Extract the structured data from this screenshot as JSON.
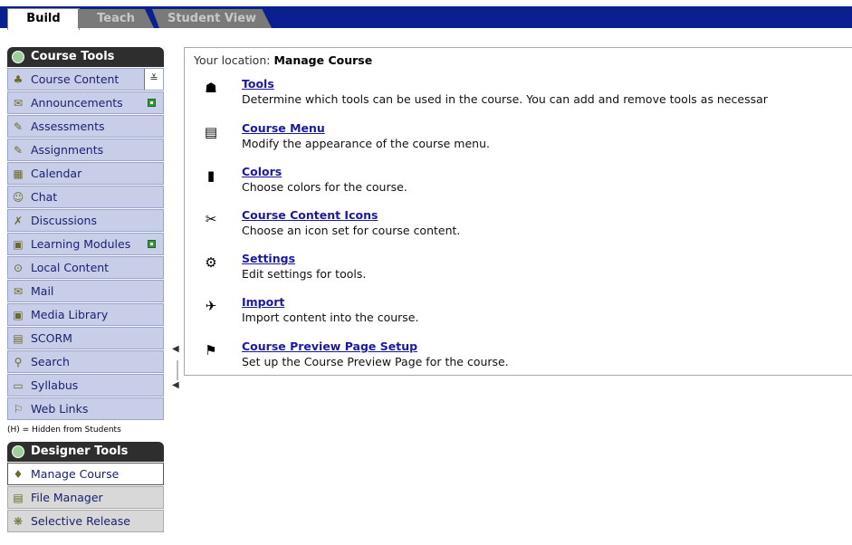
{
  "tabs": {
    "build": "Build",
    "teach": "Teach",
    "student_view": "Student View"
  },
  "sidebar": {
    "course_tools_title": "Course Tools",
    "course_tools": [
      {
        "label": "Course Content",
        "icon": "course-content-icon",
        "glyph": "♣",
        "badge": "chevron"
      },
      {
        "label": "Announcements",
        "icon": "announcements-icon",
        "glyph": "✉",
        "badge": "green"
      },
      {
        "label": "Assessments",
        "icon": "assessments-icon",
        "glyph": "✎"
      },
      {
        "label": "Assignments",
        "icon": "assignments-icon",
        "glyph": "✎"
      },
      {
        "label": "Calendar",
        "icon": "calendar-icon",
        "glyph": "▦"
      },
      {
        "label": "Chat",
        "icon": "chat-icon",
        "glyph": "☺"
      },
      {
        "label": "Discussions",
        "icon": "discussions-icon",
        "glyph": "✗"
      },
      {
        "label": "Learning Modules",
        "icon": "learning-modules-icon",
        "glyph": "▣",
        "badge": "green"
      },
      {
        "label": "Local Content",
        "icon": "local-content-icon",
        "glyph": "⊙"
      },
      {
        "label": "Mail",
        "icon": "mail-icon",
        "glyph": "✉"
      },
      {
        "label": "Media Library",
        "icon": "media-library-icon",
        "glyph": "▣"
      },
      {
        "label": "SCORM",
        "icon": "scorm-icon",
        "glyph": "▤"
      },
      {
        "label": "Search",
        "icon": "search-icon",
        "glyph": "⚲"
      },
      {
        "label": "Syllabus",
        "icon": "syllabus-icon",
        "glyph": "▭"
      },
      {
        "label": "Web Links",
        "icon": "web-links-icon",
        "glyph": "⚐"
      }
    ],
    "hidden_note": "(H) = Hidden from Students",
    "designer_tools_title": "Designer Tools",
    "designer_tools": [
      {
        "label": "Manage Course",
        "icon": "manage-course-icon",
        "glyph": "♦",
        "selected": true
      },
      {
        "label": "File Manager",
        "icon": "file-manager-icon",
        "glyph": "▤"
      },
      {
        "label": "Selective Release",
        "icon": "selective-release-icon",
        "glyph": "❋"
      }
    ]
  },
  "main": {
    "location_label": "Your location:",
    "location_value": "Manage Course",
    "tools": [
      {
        "title": "Tools",
        "desc": "Determine which tools can be used in the course. You can add and remove tools as necessar",
        "icon": "tools-icon",
        "glyph": "☗"
      },
      {
        "title": "Course Menu",
        "desc": "Modify the appearance of the course menu.",
        "icon": "course-menu-icon",
        "glyph": "▤"
      },
      {
        "title": "Colors",
        "desc": "Choose colors for the course.",
        "icon": "colors-icon",
        "glyph": "▮"
      },
      {
        "title": "Course Content Icons",
        "desc": "Choose an icon set for course content.",
        "icon": "course-content-icons-icon",
        "glyph": "✂"
      },
      {
        "title": "Settings",
        "desc": "Edit settings for tools.",
        "icon": "settings-icon",
        "glyph": "⚙"
      },
      {
        "title": "Import",
        "desc": "Import content into the course.",
        "icon": "import-icon",
        "glyph": "✈"
      },
      {
        "title": "Course Preview Page Setup",
        "desc": "Set up the Course Preview Page for the course.",
        "icon": "course-preview-icon",
        "glyph": "⚑"
      }
    ]
  },
  "colors": {
    "tab_band": "#0b1f8f",
    "nav_bg": "#c8cde8",
    "link": "#1a1aa0",
    "badge_green": "#2f9e2f"
  }
}
